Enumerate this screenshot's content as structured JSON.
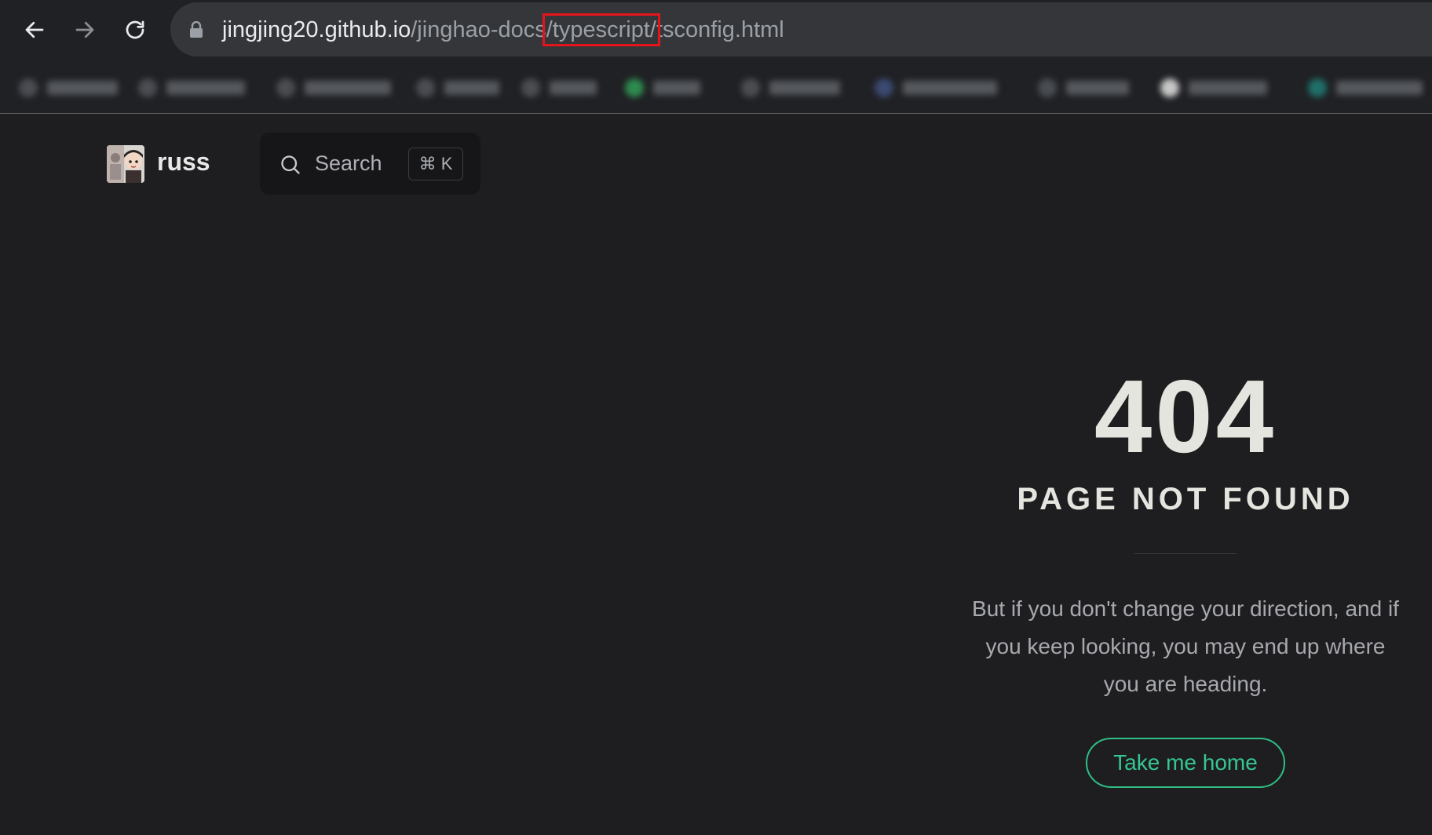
{
  "browser": {
    "url": {
      "host": "jingjing20.github.io",
      "path_before": "/jinghao-docs",
      "path_highlight": "/typescript/",
      "path_after": "tsconfig.html"
    },
    "highlight_color": "#e5141b"
  },
  "site": {
    "title": "russ",
    "search": {
      "label": "Search",
      "shortcut": "⌘ K"
    }
  },
  "not_found": {
    "code": "404",
    "title": "PAGE NOT FOUND",
    "quote": "But if you don't change your direction, and if you keep looking, you may end up where you are heading.",
    "home_button": "Take me home"
  },
  "colors": {
    "background": "#1e1e20",
    "accent": "#35c690"
  }
}
